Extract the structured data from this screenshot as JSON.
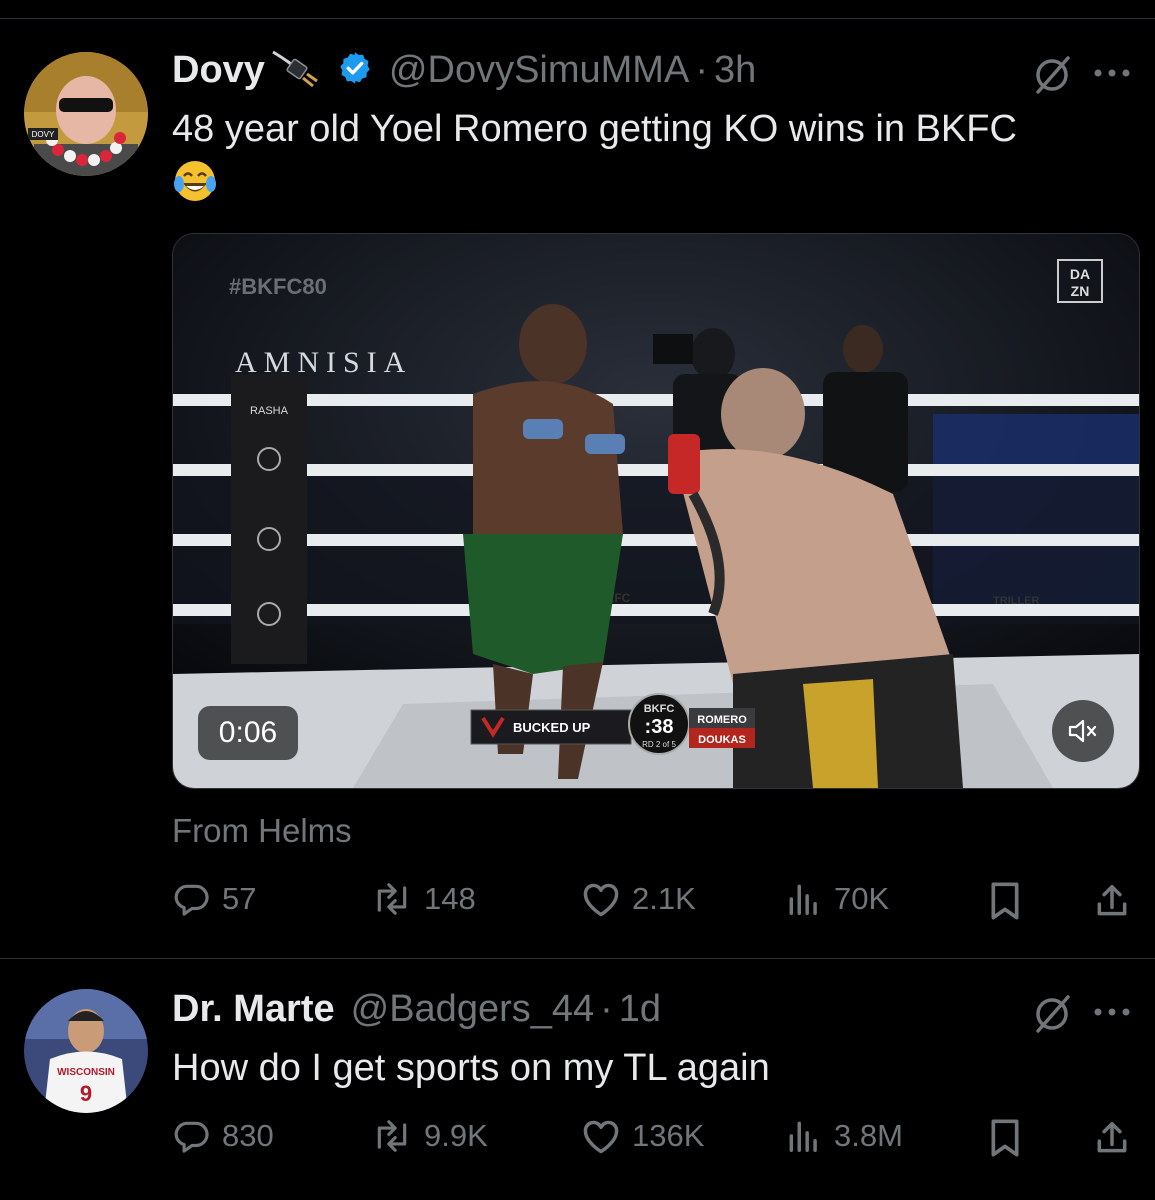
{
  "tweets": [
    {
      "name": "Dovy",
      "handle": "@DovySimuMMA",
      "separator": "·",
      "time": "3h",
      "text_line1": "48 year old Yoel Romero getting KO wins in BKFC",
      "emoji": "😂",
      "avatar_text": "DOVY",
      "media": {
        "duration": "0:06",
        "hashtag": "#BKFC80",
        "sponsor_banner": "AMNISIA",
        "network_logo_top": "DA",
        "network_logo_bottom": "ZN",
        "ring_brand": "RASHA",
        "ring_apron": "BKFC",
        "rope_brand": "TRILLER",
        "scorebug": {
          "sponsor": "BUCKED UP",
          "league": "BKFC",
          "clock": ":38",
          "round": "RD 2 of 5",
          "fighter_1": "ROMERO",
          "fighter_2": "DOUKAS"
        }
      },
      "source": "From Helms",
      "replies": "57",
      "reposts": "148",
      "likes": "2.1K",
      "views": "70K"
    },
    {
      "name": "Dr. Marte",
      "handle": "@Badgers_44",
      "separator": "·",
      "time": "1d",
      "text_line1": "How do I get sports on my TL again",
      "avatar_text": "WISCONSIN",
      "avatar_number": "9",
      "replies": "830",
      "reposts": "9.9K",
      "likes": "136K",
      "views": "3.8M"
    }
  ],
  "icons": {
    "verified": "verified-badge-icon",
    "plug": "plug-emoji-icon",
    "grok": "grok-icon",
    "more": "more-icon",
    "reply": "reply-icon",
    "repost": "repost-icon",
    "like": "heart-icon",
    "views": "views-icon",
    "bookmark": "bookmark-icon",
    "share": "share-icon",
    "mute": "volume-muted-icon"
  },
  "colors": {
    "background": "#000000",
    "text": "#e7e9ea",
    "secondary": "#71767b",
    "verified": "#1d9bf0",
    "divider": "#2f3336"
  }
}
